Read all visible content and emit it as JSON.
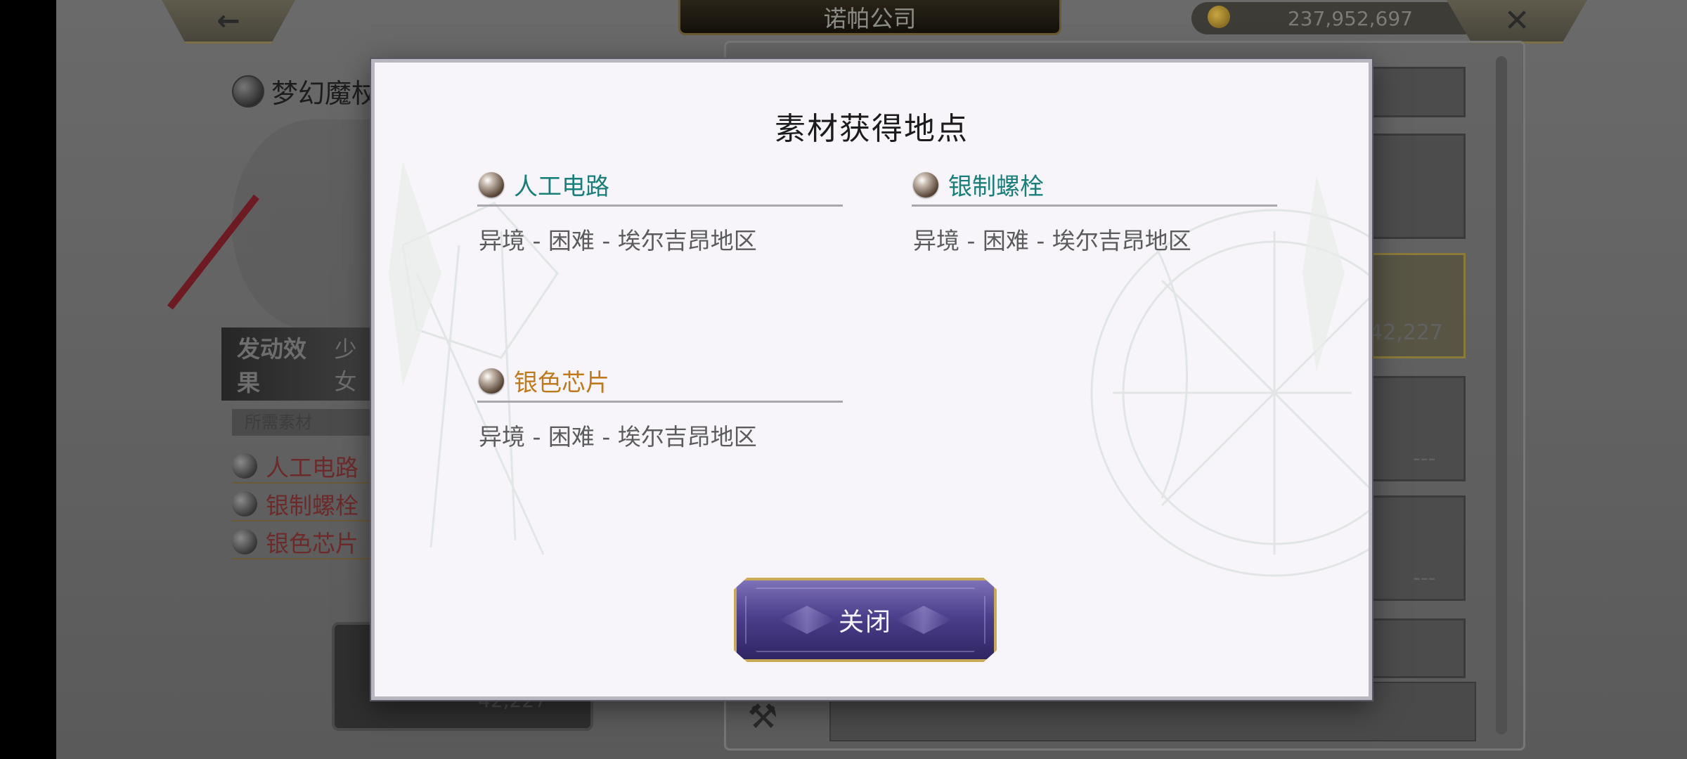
{
  "background": {
    "top_bar": {
      "back_label": "←",
      "title": "诺帕公司",
      "money": "237,952,697",
      "close_label": "✕"
    },
    "item_title": "梦幻魔杖",
    "effect": {
      "label": "发动效果",
      "value": "少女"
    },
    "materials_header": "所需素材",
    "materials": [
      {
        "name": "人工电路"
      },
      {
        "name": "银制螺栓"
      },
      {
        "name": "银色芯片"
      }
    ],
    "right_slots": [
      {
        "text": ""
      },
      {
        "text": ""
      },
      {
        "text": "42,227"
      },
      {
        "text": "---"
      },
      {
        "text": "---"
      },
      {
        "text": "---"
      }
    ],
    "bottom_number": "42,227"
  },
  "modal": {
    "title": "素材获得地点",
    "materials": [
      {
        "name": "人工电路",
        "location": "异境 - 困难 - 埃尔吉昂地区",
        "color": "#1a7f7a"
      },
      {
        "name": "银制螺栓",
        "location": "异境 - 困难 - 埃尔吉昂地区",
        "color": "#1a7f7a"
      },
      {
        "name": "银色芯片",
        "location": "异境 - 困难 - 埃尔吉昂地区",
        "color": "#c07a1e"
      }
    ],
    "close_button": "关闭"
  }
}
